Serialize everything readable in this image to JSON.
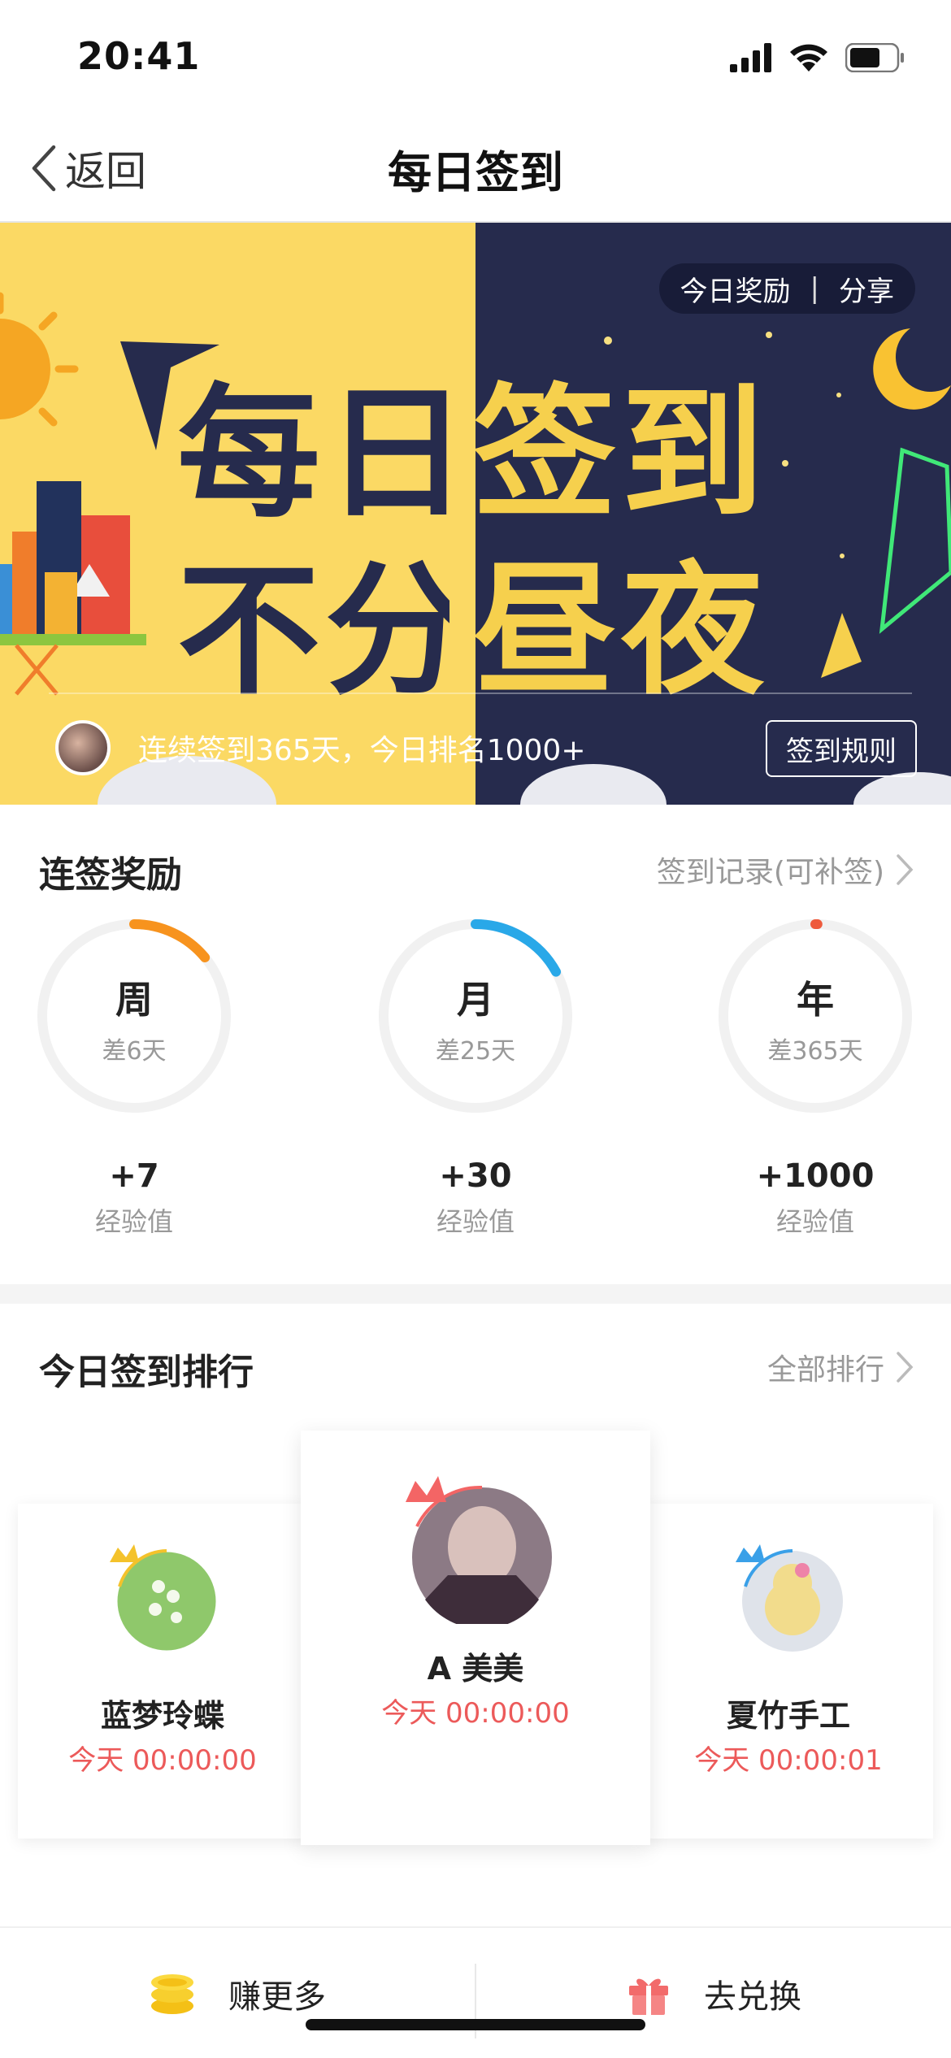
{
  "status": {
    "time": "20:41"
  },
  "nav": {
    "back_label": "返回",
    "title": "每日签到"
  },
  "banner": {
    "headline_line1": "每日签到",
    "headline_line2": "不分昼夜",
    "actions": {
      "reward": "今日奖励",
      "share": "分享"
    },
    "streak_text": "连续签到365天，今日排名1000+",
    "rules_button": "签到规则"
  },
  "rewards_section": {
    "title": "连签奖励",
    "link": "签到记录(可补签)",
    "items": [
      {
        "label": "周",
        "remaining": "差6天",
        "bonus": "+7",
        "unit": "经验值",
        "progress": 0.14,
        "color": "#f7931e"
      },
      {
        "label": "月",
        "remaining": "差25天",
        "bonus": "+30",
        "unit": "经验值",
        "progress": 0.17,
        "color": "#29a8e8"
      },
      {
        "label": "年",
        "remaining": "差365天",
        "bonus": "+1000",
        "unit": "经验值",
        "progress": 0.0,
        "color": "#ee5a3c"
      }
    ]
  },
  "ranking_section": {
    "title": "今日签到排行",
    "link": "全部排行",
    "entries": [
      {
        "name": "蓝梦玲蝶",
        "time": "今天 00:00:00",
        "crown": "gold-crown"
      },
      {
        "name": "A 美美",
        "time": "今天 00:00:00",
        "crown": "red-crown"
      },
      {
        "name": "夏竹手工",
        "time": "今天 00:00:01",
        "crown": "blue-crown"
      }
    ]
  },
  "bottom_bar": {
    "earn_label": "赚更多",
    "redeem_label": "去兑换"
  }
}
